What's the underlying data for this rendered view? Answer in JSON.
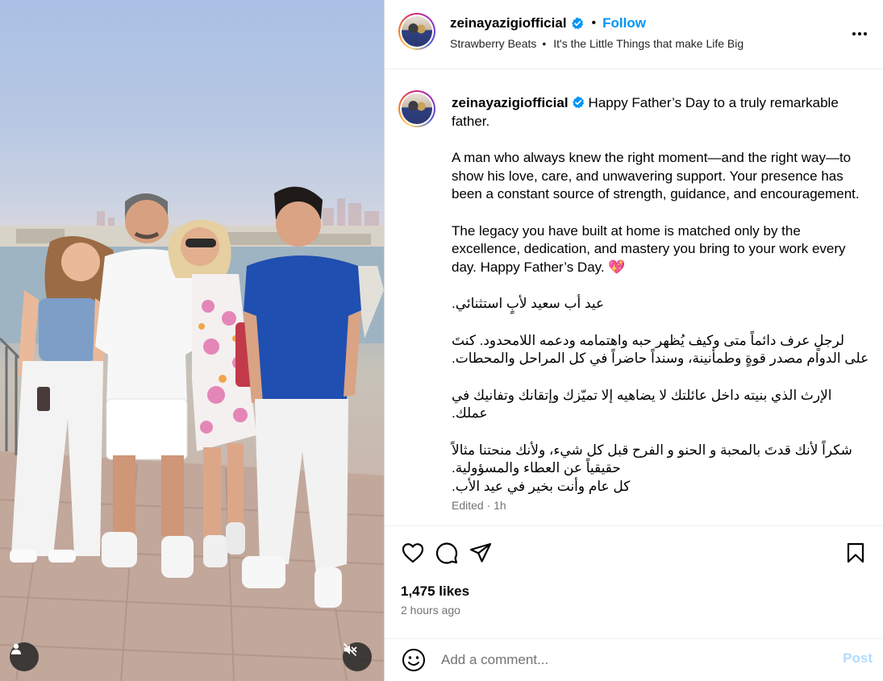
{
  "post": {
    "username": "zeinayazigiofficial",
    "follow_label": "Follow",
    "header_dot": "•",
    "audio": "Strawberry Beats",
    "audio_sep": "•",
    "location": "It's the Little Things that make Life Big"
  },
  "caption": {
    "username": "zeinayazigiofficial",
    "line_1": "Happy Father’s Day to a truly remarkable father.",
    "para_2": "A man who always knew the right moment—and the right way—to show his love, care, and unwavering support. Your presence has been a constant source of strength, guidance, and encouragement.",
    "para_3": "The legacy you have built at home is matched only by the excellence, dedication, and mastery you bring to your work every day. Happy Father’s Day.",
    "heart_emoji": "💖",
    "arabic_1": "عيد أب سعيد لأبٍ استثنائي.",
    "arabic_2": "لرجلٍ عرف دائماً متى وكيف يُظهر حبه واهتمامه ودعمه اللامحدود. كنتَ على الدوام مصدر قوةٍ وطمأنينة، وسنداً حاضراً في كل المراحل والمحطات.",
    "arabic_3": "الإرث الذي بنيته داخل عائلتك لا يضاهيه إلا تميّزك وإتقانك وتفانيك في عملك.",
    "arabic_4a": "شكراً لأنك قدتَ بالمحبة و الحنو و الفرح قبل كل شيء، ولأنك منحتنا مثالاً حقيقياً عن العطاء والمسؤولية.",
    "arabic_4b": "كل عام وأنت بخير في عيد الأب.",
    "edited": "Edited · 1h"
  },
  "engagement": {
    "likes": "1,475 likes",
    "time_ago": "2 hours ago"
  },
  "comment": {
    "placeholder": "Add a comment...",
    "post_label": "Post"
  },
  "icons": {
    "verified": "verified-badge-icon",
    "more": "more-options-icon",
    "like": "heart-icon",
    "comment": "comment-icon",
    "share": "share-icon",
    "save": "bookmark-icon",
    "emoji": "emoji-icon",
    "tag": "user-tag-icon",
    "mute": "muted-speaker-icon"
  },
  "colors": {
    "accent": "#0095f6",
    "secondary_text": "#737373",
    "post_disabled": "#b3dbff",
    "heart": "#e8336d"
  }
}
